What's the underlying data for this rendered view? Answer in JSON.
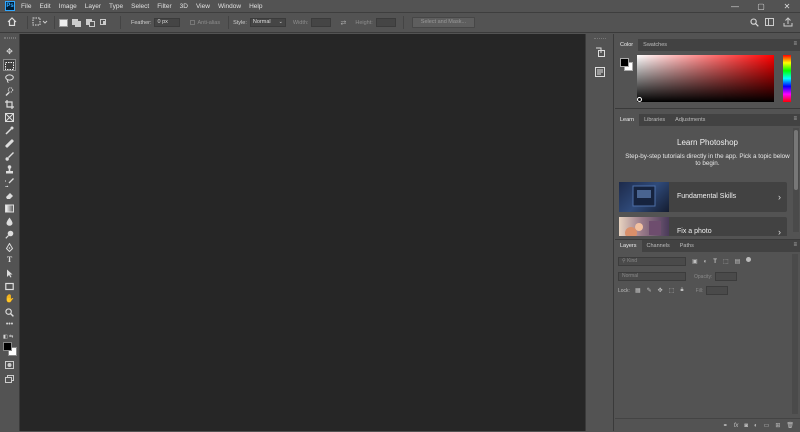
{
  "app": {
    "logo": "Ps"
  },
  "menu": [
    "File",
    "Edit",
    "Image",
    "Layer",
    "Type",
    "Select",
    "Filter",
    "3D",
    "View",
    "Window",
    "Help"
  ],
  "window_controls": {
    "minimize": "—",
    "restore": "▢",
    "close": "✕"
  },
  "options_bar": {
    "feather_label": "Feather:",
    "feather_value": "0 px",
    "antialias_label": "Anti-alias",
    "style_label": "Style:",
    "style_value": "Normal",
    "width_label": "Width:",
    "height_label": "Height:",
    "select_mask_label": "Select and Mask..."
  },
  "color_panel": {
    "tabs": [
      "Color",
      "Swatches"
    ],
    "active_tab": "Color",
    "hue_color": "#ff0000",
    "foreground": "#000000",
    "background": "#ffffff"
  },
  "learn_panel": {
    "tabs": [
      "Learn",
      "Libraries",
      "Adjustments"
    ],
    "active_tab": "Learn",
    "title": "Learn Photoshop",
    "description": "Step-by-step tutorials directly in the app. Pick a topic below to begin.",
    "cards": [
      {
        "label": "Fundamental Skills"
      },
      {
        "label": "Fix a photo"
      }
    ]
  },
  "layers_panel": {
    "tabs": [
      "Layers",
      "Channels",
      "Paths"
    ],
    "active_tab": "Layers",
    "filter_placeholder": "Kind",
    "blend_mode": "Normal",
    "opacity_label": "Opacity:",
    "lock_label": "Lock:",
    "fill_label": "Fill:"
  }
}
